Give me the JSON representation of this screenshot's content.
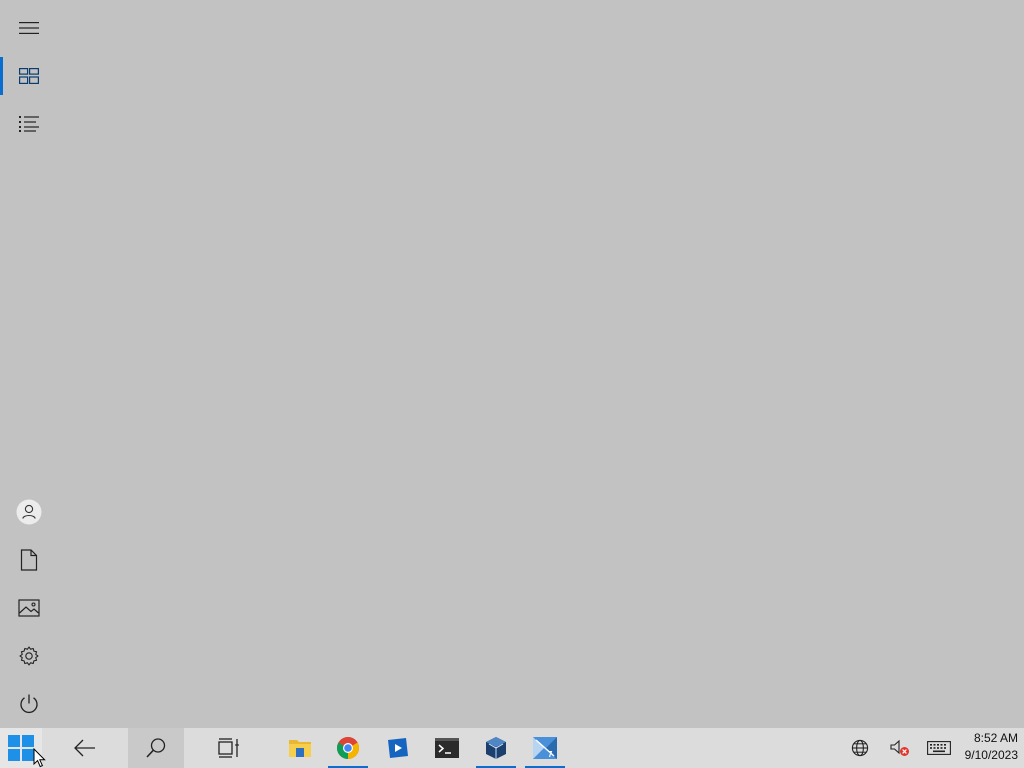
{
  "start_menu": {
    "rail": {
      "top_items": [
        {
          "name": "menu",
          "icon": "hamburger-icon"
        },
        {
          "name": "pinned-tiles",
          "icon": "tiles-icon",
          "active": true
        },
        {
          "name": "all-apps",
          "icon": "list-icon"
        }
      ],
      "bottom_items": [
        {
          "name": "account",
          "icon": "user-icon"
        },
        {
          "name": "documents",
          "icon": "document-icon"
        },
        {
          "name": "pictures",
          "icon": "picture-icon"
        },
        {
          "name": "settings",
          "icon": "gear-icon"
        },
        {
          "name": "power",
          "icon": "power-icon"
        }
      ]
    }
  },
  "taskbar": {
    "start_icon": "windows-logo-icon",
    "buttons": [
      {
        "name": "back",
        "icon": "back-arrow-icon"
      },
      {
        "name": "search",
        "icon": "search-icon"
      },
      {
        "name": "task-view",
        "icon": "task-view-icon"
      },
      {
        "name": "file-explorer",
        "icon": "folder-icon"
      },
      {
        "name": "chrome",
        "icon": "chrome-icon",
        "running": true
      },
      {
        "name": "media-player",
        "icon": "video-icon"
      },
      {
        "name": "terminal",
        "icon": "terminal-icon"
      },
      {
        "name": "virtualbox",
        "icon": "virtualbox-icon",
        "running": true
      },
      {
        "name": "app",
        "icon": "app-icon",
        "running": true
      }
    ],
    "tray": [
      {
        "name": "network",
        "icon": "globe-icon"
      },
      {
        "name": "volume-muted",
        "icon": "speaker-muted-icon"
      },
      {
        "name": "keyboard",
        "icon": "keyboard-icon"
      }
    ],
    "clock": {
      "time": "8:52 AM",
      "date": "9/10/2023"
    }
  },
  "colors": {
    "desktop": "#c2c2c2",
    "taskbar": "#dcdcdc",
    "accent": "#0a6ed1"
  }
}
